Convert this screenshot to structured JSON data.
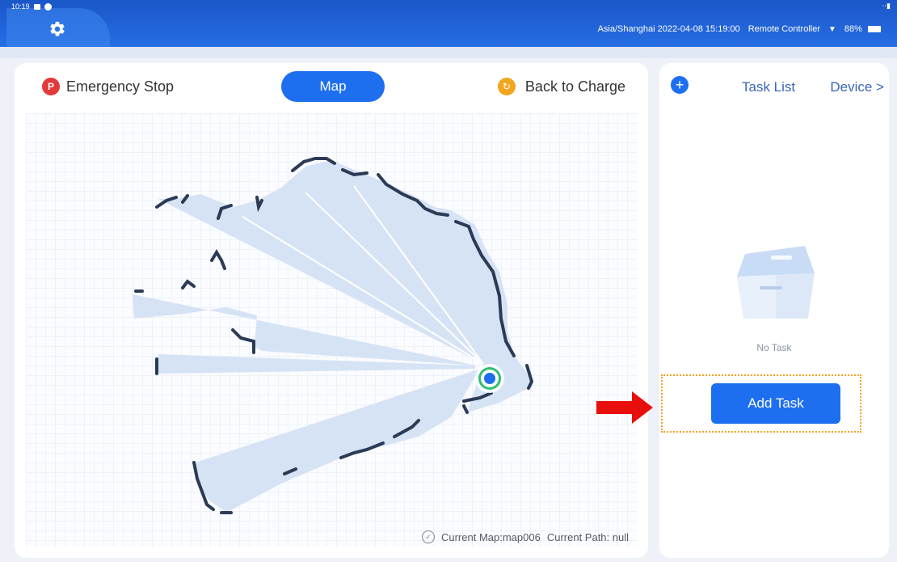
{
  "status_bar": {
    "time": "10:19",
    "signal": "⋅⋅▮"
  },
  "header": {
    "timezone_time": "Asia/Shanghai 2022-04-08 15:19:00",
    "mode": "Remote Controller",
    "battery": "88%"
  },
  "map_panel": {
    "emergency_stop": "Emergency Stop",
    "map_tab": "Map",
    "back_to_charge": "Back to Charge",
    "current_map": "Current Map:map006",
    "current_path": "Current Path:  null"
  },
  "task_panel": {
    "task_list": "Task List",
    "device": "Device >",
    "no_task": "No Task",
    "add_task": "Add Task"
  },
  "colors": {
    "primary": "#1e6ff0",
    "emergency": "#e23a3a",
    "charge": "#f2a620",
    "annotation": "#f2a220",
    "arrow": "#e8100c"
  }
}
